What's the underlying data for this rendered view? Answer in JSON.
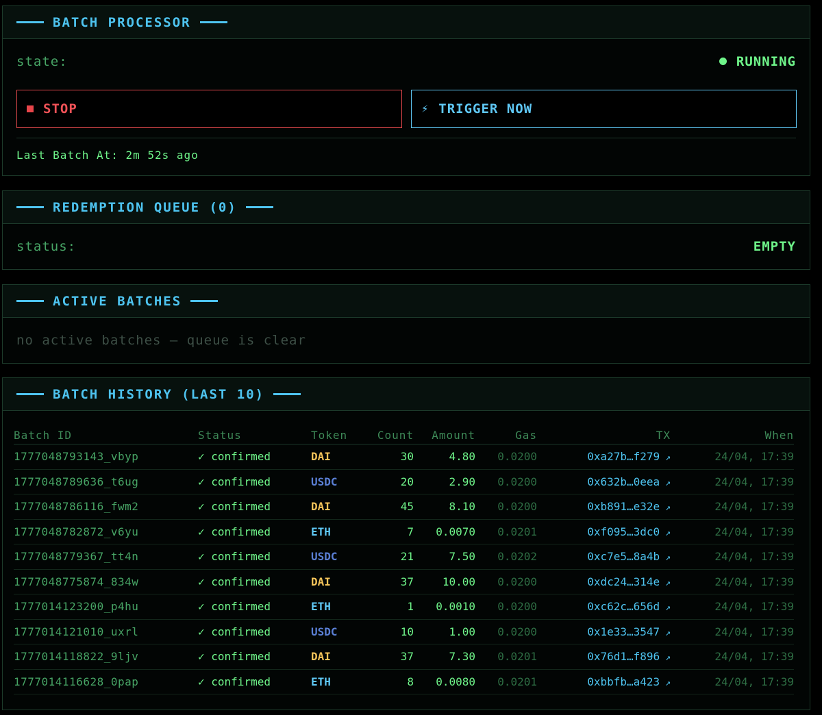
{
  "batch_processor": {
    "title": "BATCH PROCESSOR",
    "state_label": "state:",
    "state_value": "RUNNING",
    "stop_label": "STOP",
    "trigger_label": "TRIGGER NOW",
    "trigger_icon": "⚡",
    "last_batch": "Last Batch At: 2m 52s ago"
  },
  "redemption_queue": {
    "title": "REDEMPTION QUEUE (0)",
    "status_label": "status:",
    "status_value": "EMPTY"
  },
  "active_batches": {
    "title": "ACTIVE BATCHES",
    "empty_message": "no active batches — queue is clear"
  },
  "history": {
    "title": "BATCH HISTORY (LAST 10)",
    "columns": [
      "Batch ID",
      "Status",
      "Token",
      "Count",
      "Amount",
      "Gas",
      "TX",
      "When"
    ],
    "token_colors": {
      "DAI": "#f4c45a",
      "USDC": "#5a7fd4",
      "ETH": "#5fc7f4"
    },
    "rows": [
      {
        "id": "1777048793143_vbyp",
        "status": "✓ confirmed",
        "token": "DAI",
        "count": "30",
        "amount": "4.80",
        "gas": "0.0200",
        "tx": "0xa27b…f279",
        "when": "24/04, 17:39"
      },
      {
        "id": "1777048789636_t6ug",
        "status": "✓ confirmed",
        "token": "USDC",
        "count": "20",
        "amount": "2.90",
        "gas": "0.0200",
        "tx": "0x632b…0eea",
        "when": "24/04, 17:39"
      },
      {
        "id": "1777048786116_fwm2",
        "status": "✓ confirmed",
        "token": "DAI",
        "count": "45",
        "amount": "8.10",
        "gas": "0.0200",
        "tx": "0xb891…e32e",
        "when": "24/04, 17:39"
      },
      {
        "id": "1777048782872_v6yu",
        "status": "✓ confirmed",
        "token": "ETH",
        "count": "7",
        "amount": "0.0070",
        "gas": "0.0201",
        "tx": "0xf095…3dc0",
        "when": "24/04, 17:39"
      },
      {
        "id": "1777048779367_tt4n",
        "status": "✓ confirmed",
        "token": "USDC",
        "count": "21",
        "amount": "7.50",
        "gas": "0.0202",
        "tx": "0xc7e5…8a4b",
        "when": "24/04, 17:39"
      },
      {
        "id": "1777048775874_834w",
        "status": "✓ confirmed",
        "token": "DAI",
        "count": "37",
        "amount": "10.00",
        "gas": "0.0200",
        "tx": "0xdc24…314e",
        "when": "24/04, 17:39"
      },
      {
        "id": "1777014123200_p4hu",
        "status": "✓ confirmed",
        "token": "ETH",
        "count": "1",
        "amount": "0.0010",
        "gas": "0.0200",
        "tx": "0xc62c…656d",
        "when": "24/04, 17:39"
      },
      {
        "id": "1777014121010_uxrl",
        "status": "✓ confirmed",
        "token": "USDC",
        "count": "10",
        "amount": "1.00",
        "gas": "0.0200",
        "tx": "0x1e33…3547",
        "when": "24/04, 17:39"
      },
      {
        "id": "1777014118822_9ljv",
        "status": "✓ confirmed",
        "token": "DAI",
        "count": "37",
        "amount": "7.30",
        "gas": "0.0201",
        "tx": "0x76d1…f896",
        "when": "24/04, 17:39"
      },
      {
        "id": "1777014116628_0pap",
        "status": "✓ confirmed",
        "token": "ETH",
        "count": "8",
        "amount": "0.0080",
        "gas": "0.0201",
        "tx": "0xbbfb…a423",
        "when": "24/04, 17:39"
      }
    ]
  }
}
